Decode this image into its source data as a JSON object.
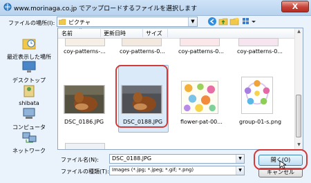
{
  "window": {
    "title": "www.morinaga.co.jp でアップロードするファイルを選択します",
    "close_label": "X"
  },
  "toolbar": {
    "lookin_label": "ファイルの場所(I):",
    "lookin_value": "ピクチャ"
  },
  "places": [
    {
      "label": "最近表示した場所",
      "icon": "recent-places-icon"
    },
    {
      "label": "デスクトップ",
      "icon": "desktop-icon"
    },
    {
      "label": "shibata",
      "icon": "user-folder-icon"
    },
    {
      "label": "コンピュータ",
      "icon": "computer-icon"
    },
    {
      "label": "ネットワーク",
      "icon": "network-icon"
    }
  ],
  "columns": [
    "名前",
    "更新日時",
    "サイズ"
  ],
  "files_top": [
    "coy-patterns-...",
    "coy-patterns-0...",
    "coy-patterns-0...",
    "coy-patterns-0..."
  ],
  "files": [
    {
      "name": "DSC_0186.JPG"
    },
    {
      "name": "DSC_0188.JPG",
      "selected": true
    },
    {
      "name": "flower-pat-00..."
    },
    {
      "name": "group-01-s.png"
    }
  ],
  "footer": {
    "filename_label": "ファイル名(N):",
    "filename_value": "DSC_0188.JPG",
    "filetype_label": "ファイルの種類(T):",
    "filetype_value": "Images (*.jpg; *.jpeg; *.gif; *.png)",
    "open_label": "開く(O)",
    "cancel_label": "キャンセル"
  },
  "colors": {
    "highlight_red": "#d23a3a",
    "selection": "#dbeaf9"
  }
}
